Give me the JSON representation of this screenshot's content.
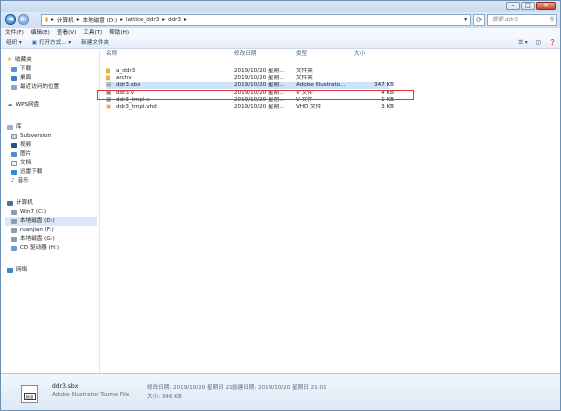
{
  "window": {
    "minimize": "–",
    "maximize": "□",
    "close": "✕"
  },
  "address": {
    "segments": [
      "计算机",
      "本地磁盘 (D:)",
      "lattice_ddr3",
      "ddr3"
    ],
    "search_placeholder": "搜索 ddr3"
  },
  "menu": [
    "文件(F)",
    "编辑(E)",
    "查看(V)",
    "工具(T)",
    "帮助(H)"
  ],
  "toolbar": {
    "organize": "组织 ▾",
    "open_with": "打开方式... ▾",
    "new_folder": "新建文件夹"
  },
  "nav": {
    "favorites": "收藏夹",
    "fav_items": [
      "下载",
      "桌面",
      "最近访问的位置"
    ],
    "wps": "WPS网盘",
    "libraries": "库",
    "lib_items": [
      "Subversion",
      "视频",
      "图片",
      "文档",
      "迅雷下载",
      "音乐"
    ],
    "computer": "计算机",
    "drives": [
      "Win7 (C:)",
      "本地磁盘 (D:)",
      "ruanjian (F:)",
      "本地磁盘 (G:)",
      "CD 驱动器 (H:)"
    ],
    "network": "网络"
  },
  "columns": {
    "name": "名称",
    "date": "修改日期",
    "type": "类型",
    "size": "大小"
  },
  "files": [
    {
      "name": "a_ddr3",
      "date": "2019/10/20 星期...",
      "type": "文件夹",
      "size": ""
    },
    {
      "name": "archv",
      "date": "2019/10/20 星期...",
      "type": "文件夹",
      "size": ""
    },
    {
      "name": "ddr3.sbx",
      "date": "2019/10/20 星期...",
      "type": "Adobe Illustrato...",
      "size": "347 KB"
    },
    {
      "name": "ddr3.v",
      "date": "2019/10/20 星期...",
      "type": "V 文件",
      "size": "4 KB"
    },
    {
      "name": "ddr3_tmpl.v",
      "date": "2019/10/20 星期...",
      "type": "V 文件",
      "size": "1 KB"
    },
    {
      "name": "ddr3_tmpl.vhd",
      "date": "2019/10/20 星期...",
      "type": "VHD 文件",
      "size": "3 KB"
    }
  ],
  "details": {
    "filename": "ddr3.sbx",
    "filetype": "Adobe Illustrator Tsume File",
    "modified": "修改日期: 2019/10/20 星期日 21...",
    "created": "创建日期: 2019/10/20 星期日 21:01",
    "size": "大小: 346 KB"
  }
}
